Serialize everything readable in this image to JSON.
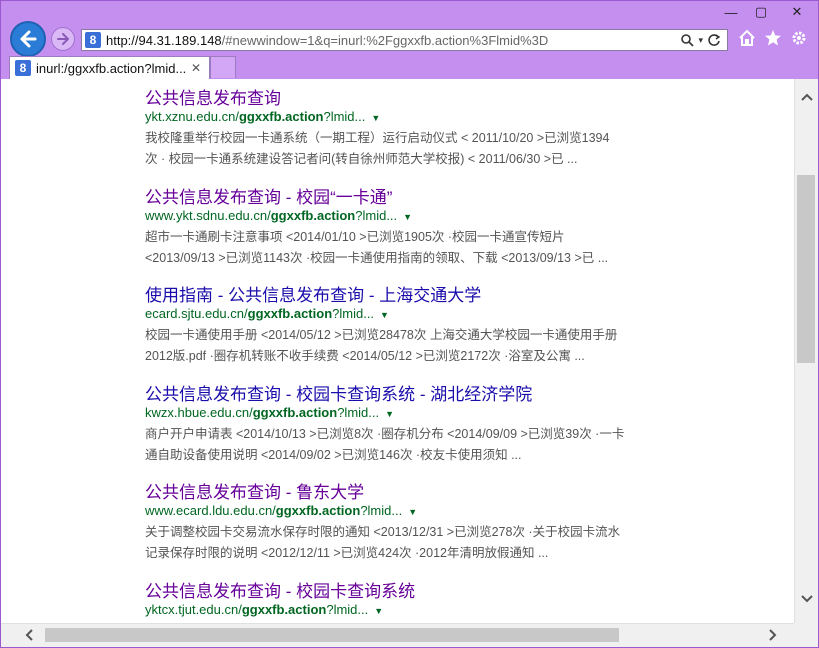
{
  "browser": {
    "url_host": "http://94.31.189.148",
    "url_rest": "/#newwindow=1&q=inurl:%2Fggxxfb.action%3Flmid%3D",
    "tab_title": "inurl:/ggxxfb.action?lmid...",
    "favicon_letter": "8",
    "window_controls": {
      "minimize": "—",
      "maximize": "▢",
      "close": "✕"
    },
    "accent_color": "#c58ff0"
  },
  "results": [
    {
      "title": "公共信息发布查询",
      "url_prefix": "ykt.xznu.edu.cn/",
      "url_bold": "ggxxfb.action",
      "url_suffix": "?lmid...",
      "snippet_line1": "我校隆重举行校园一卡通系统（一期工程）运行启动仪式 < 2011/10/20 >已浏览1394",
      "snippet_line2": "次 · 校园一卡通系统建设答记者问(转自徐州师范大学校报) < 2011/06/30 >已 ...",
      "visited": true
    },
    {
      "title": "公共信息发布查询 - 校园“一卡通”",
      "url_prefix": "www.ykt.sdnu.edu.cn/",
      "url_bold": "ggxxfb.action",
      "url_suffix": "?lmid...",
      "snippet_line1": "超市一卡通刷卡注意事项 <2014/01/10 >已浏览1905次 ·校园一卡通宣传短片",
      "snippet_line2": "<2013/09/13 >已浏览1143次 ·校园一卡通使用指南的领取、下载 <2013/09/13 >已 ...",
      "visited": true
    },
    {
      "title": "使用指南 - 公共信息发布查询 - 上海交通大学",
      "url_prefix": "ecard.sjtu.edu.cn/",
      "url_bold": "ggxxfb.action",
      "url_suffix": "?lmid...",
      "snippet_line1": "校园一卡通使用手册 <2014/05/12 >已浏览28478次 上海交通大学校园一卡通使用手册",
      "snippet_line2": "2012版.pdf ·圈存机转账不收手续费 <2014/05/12 >已浏览2172次 ·浴室及公寓 ...",
      "visited": false
    },
    {
      "title": "公共信息发布查询 - 校园卡查询系统 - 湖北经济学院",
      "url_prefix": "kwzx.hbue.edu.cn/",
      "url_bold": "ggxxfb.action",
      "url_suffix": "?lmid...",
      "snippet_line1": "商户开户申请表 <2014/10/13 >已浏览8次 ·圈存机分布 <2014/09/09 >已浏览39次 ·一卡",
      "snippet_line2": "通自助设备使用说明 <2014/09/02 >已浏览146次 ·校友卡使用须知 ...",
      "visited": false
    },
    {
      "title": "公共信息发布查询 - 鲁东大学",
      "url_prefix": "www.ecard.ldu.edu.cn/",
      "url_bold": "ggxxfb.action",
      "url_suffix": "?lmid...",
      "snippet_line1": "关于调整校园卡交易流水保存时限的通知 <2013/12/31 >已浏览278次 ·关于校园卡流水",
      "snippet_line2": "记录保存时限的说明 <2012/12/11 >已浏览424次 ·2012年清明放假通知 ...",
      "visited": true
    },
    {
      "title": "公共信息发布查询 - 校园卡查询系统",
      "url_prefix": "yktcx.tjut.edu.cn/",
      "url_bold": "ggxxfb.action",
      "url_suffix": "?lmid...",
      "snippet_line1": "",
      "snippet_line2": "",
      "visited": true
    }
  ]
}
